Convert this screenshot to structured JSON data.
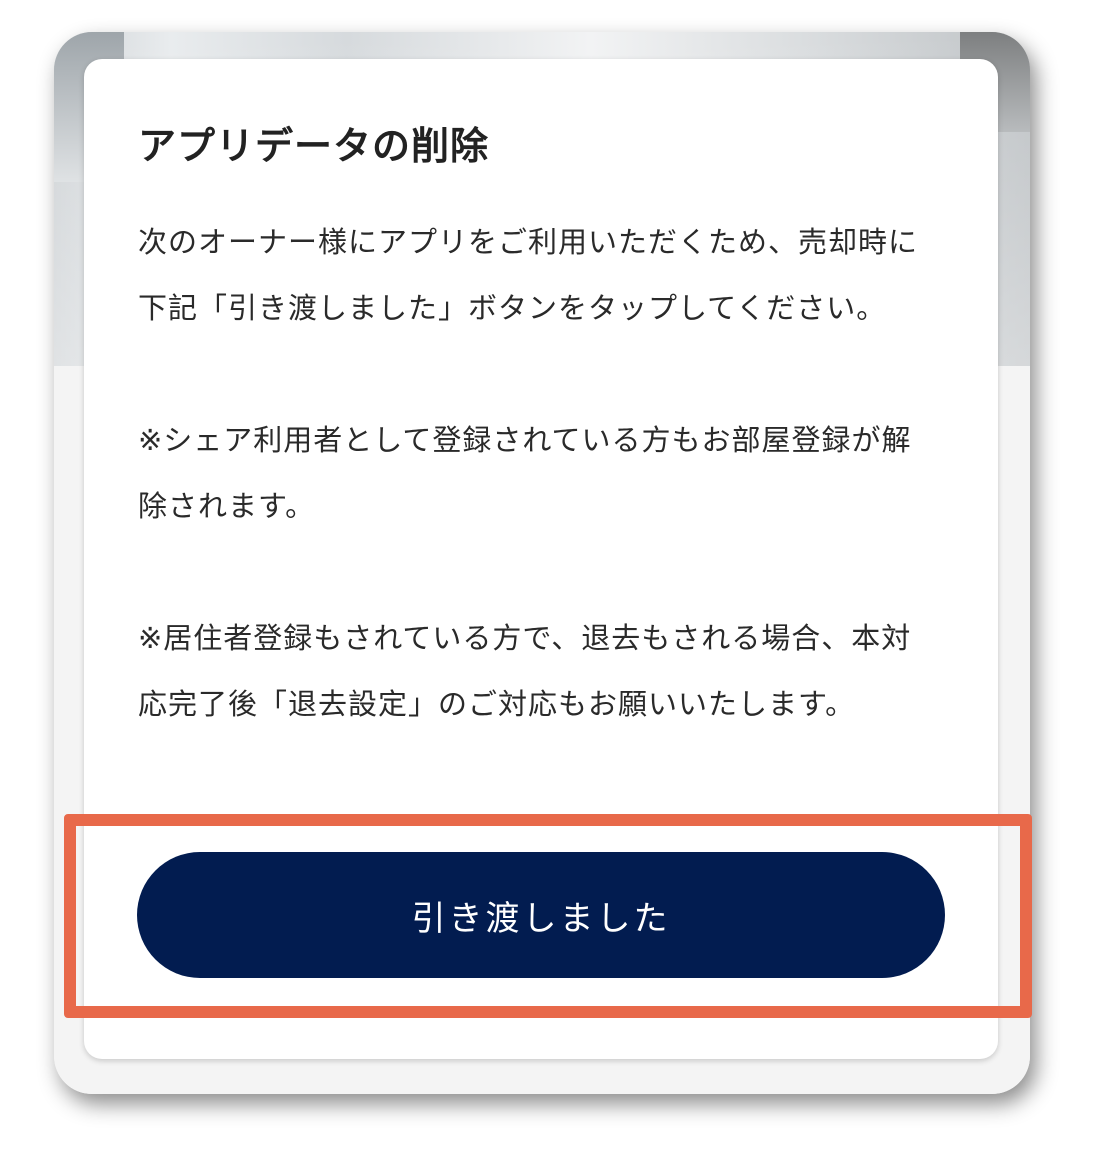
{
  "modal": {
    "title": "アプリデータの削除",
    "paragraphs": [
      "次のオーナー様にアプリをご利用いただくため、売却時に下記「引き渡しました」ボタンをタップしてください。",
      "※シェア利用者として登録されている方もお部屋登録が解除されます。",
      "※居住者登録もされている方で、退去もされる場合、本対応完了後「退去設定」のご対応もお願いいたします。"
    ],
    "button_label": "引き渡しました"
  },
  "colors": {
    "button_bg": "#021c50",
    "highlight": "#e8694a"
  }
}
